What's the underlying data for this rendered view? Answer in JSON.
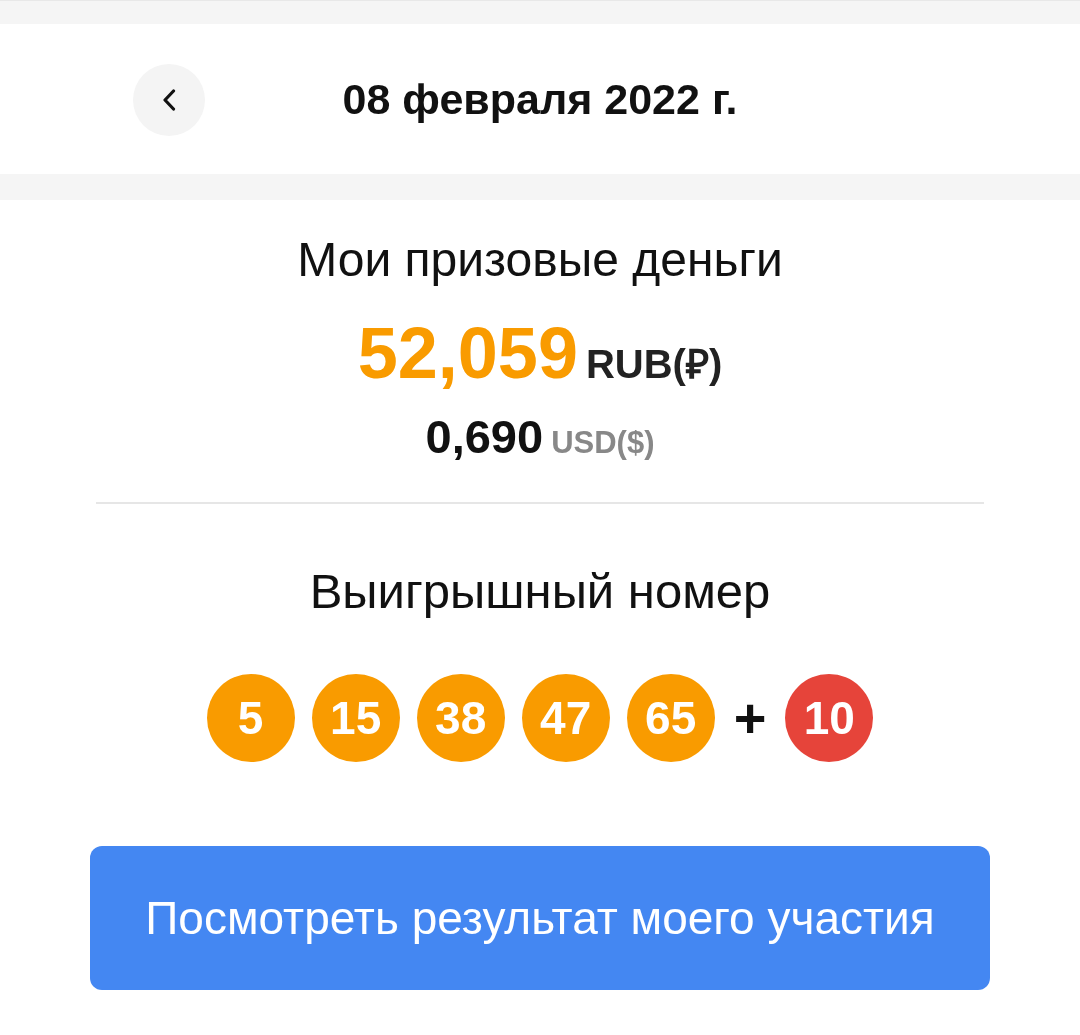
{
  "header": {
    "title": "08 февраля 2022 г."
  },
  "prize": {
    "label": "Мои призовые деньги",
    "amount": "52,059",
    "currency": "RUB(₽)",
    "usd_amount": "0,690",
    "usd_currency": "USD($)"
  },
  "winning": {
    "label": "Выигрышный номер",
    "main_balls": [
      {
        "number": "5",
        "color": "#f99b00"
      },
      {
        "number": "15",
        "color": "#f99b00"
      },
      {
        "number": "38",
        "color": "#f99b00"
      },
      {
        "number": "47",
        "color": "#f99b00"
      },
      {
        "number": "65",
        "color": "#f99b00"
      }
    ],
    "separator": "+",
    "bonus_balls": [
      {
        "number": "10",
        "color": "#e6443a"
      }
    ]
  },
  "action_button": {
    "label": "Посмотреть результат моего участия"
  }
}
